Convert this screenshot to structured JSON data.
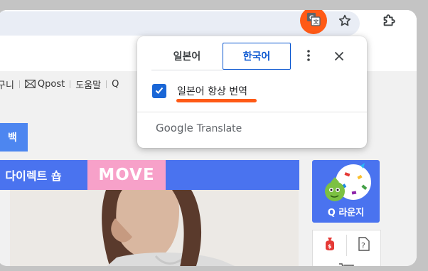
{
  "page": {
    "util_links": [
      "구니",
      "Qpost",
      "도움말",
      "Q"
    ],
    "blue_tab_label": "백",
    "direct_shop_label": "| 다이렉트 숍",
    "move_badge": "MOVE",
    "q_lounge_label": "Q 라운지",
    "side_icons": [
      "money-bag-icon",
      "help-doc-icon",
      "cart-icon"
    ]
  },
  "toolbar": {
    "icons": [
      "translate-icon",
      "star-icon",
      "extensions-icon"
    ],
    "highlight_color": "#ff5a16"
  },
  "translate_popup": {
    "tabs": [
      {
        "label": "일본어",
        "active": false
      },
      {
        "label": "한국어",
        "active": true
      }
    ],
    "always_translate_label": "일본어 항상 번역",
    "always_translate_checked": true,
    "brand_google": "Google",
    "brand_translate": "Translate",
    "accent_color": "#0b57d0"
  }
}
